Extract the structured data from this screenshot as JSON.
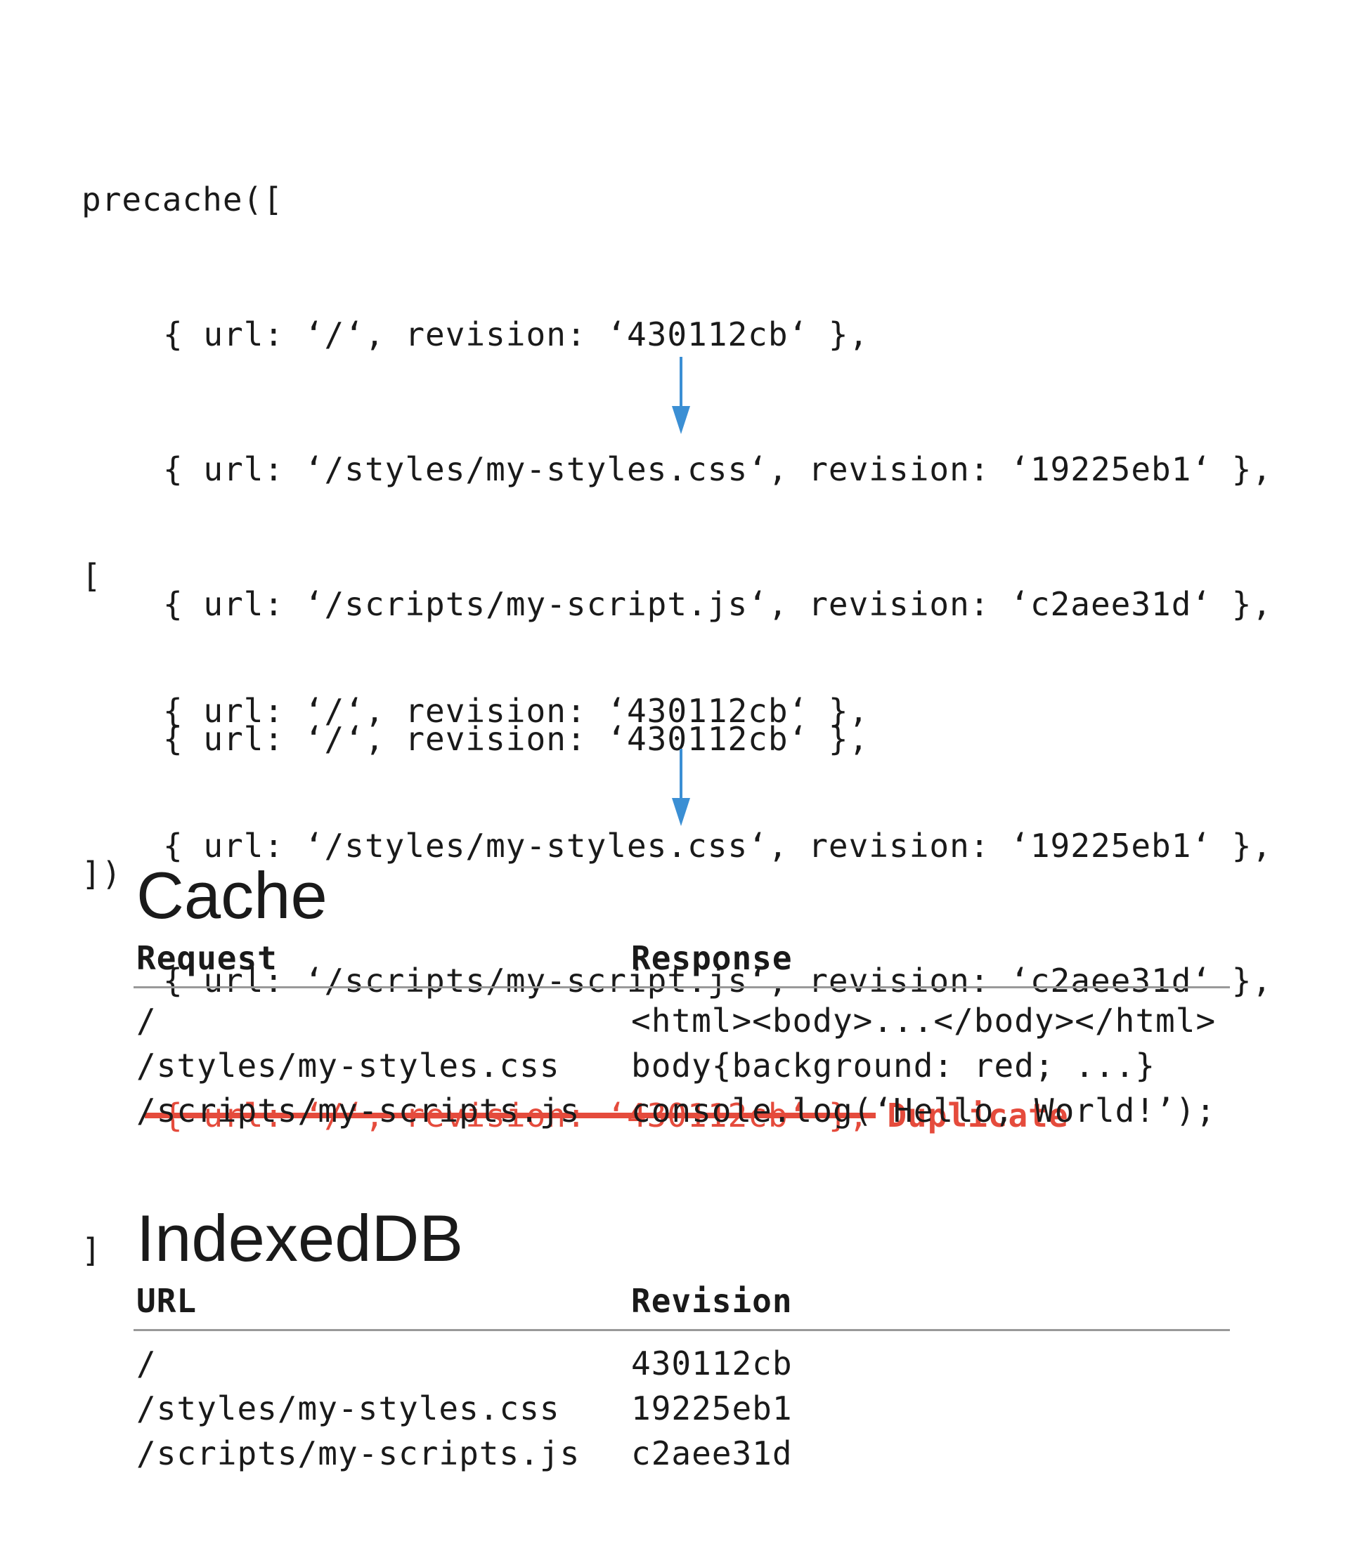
{
  "precache_block": {
    "lines": [
      "precache([",
      "{ url: ‘/‘, revision: ‘430112cb‘ },",
      "{ url: ‘/styles/my-styles.css‘, revision: ‘19225eb1‘ },",
      "{ url: ‘/scripts/my-script.js‘, revision: ‘c2aee31d‘ },",
      "{ url: ‘/‘, revision: ‘430112cb‘ },",
      "])"
    ]
  },
  "array_block": {
    "open": "[",
    "lines": [
      "{ url: ‘/‘, revision: ‘430112cb‘ },",
      "{ url: ‘/styles/my-styles.css‘, revision: ‘19225eb1‘ },",
      "{ url: ‘/scripts/my-script.js‘, revision: ‘c2aee31d‘ },"
    ],
    "duplicate_line": "{ url: ‘/‘, revision: ‘430112cb‘ },",
    "duplicate_label": "Duplicate",
    "close": "]"
  },
  "cache": {
    "title": "Cache",
    "headers": [
      "Request",
      "Response"
    ],
    "rows": [
      [
        "/",
        "<html><body>...</body></html>"
      ],
      [
        "/styles/my-styles.css",
        "body{background: red; ...}"
      ],
      [
        "/scripts/my-scripts.js",
        "console.log(‘Hello, World!’);"
      ]
    ]
  },
  "indexeddb": {
    "title": "IndexedDB",
    "headers": [
      "URL",
      "Revision"
    ],
    "rows": [
      [
        "/",
        "430112cb"
      ],
      [
        "/styles/my-styles.css",
        "19225eb1"
      ],
      [
        "/scripts/my-scripts.js",
        "c2aee31d"
      ]
    ]
  },
  "colors": {
    "arrow": "#3b8fd4",
    "duplicate": "#e54b3c",
    "rule": "#999999",
    "text": "#1a1a1a"
  }
}
